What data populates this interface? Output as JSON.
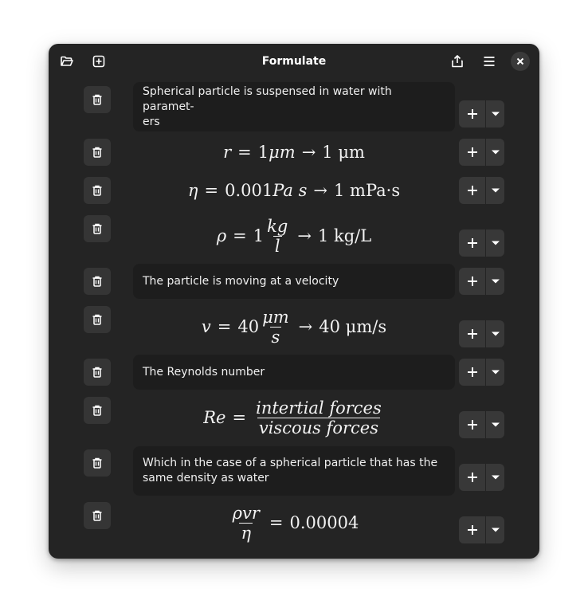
{
  "window": {
    "title": "Formulate",
    "icons": {
      "open": "folder-open-icon",
      "new": "add-document-icon",
      "share": "share-icon",
      "menu": "hamburger-menu-icon",
      "close": "close-icon"
    }
  },
  "cells": [
    {
      "type": "text",
      "text": "Spherical particle is suspensed in water with paramet-",
      "text2": "ers"
    },
    {
      "type": "math",
      "lhs": "r",
      "rel": "=",
      "val": "1",
      "unit": "μm",
      "arrow": "→",
      "result": "1 μm"
    },
    {
      "type": "math",
      "lhs": "η",
      "rel": "=",
      "val": "0.001",
      "unit": "Pa s",
      "arrow": "→",
      "result": "1 mPa·s"
    },
    {
      "type": "math",
      "lhs": "ρ",
      "rel": "=",
      "val": "1",
      "num": "kg",
      "den": "l",
      "arrow": "→",
      "result": "1 kg/L"
    },
    {
      "type": "text",
      "text": "The particle is moving at a velocity"
    },
    {
      "type": "math",
      "lhs": "v",
      "rel": "=",
      "val": "40",
      "num": "μm",
      "den": "s",
      "arrow": "→",
      "result": "40 μm/s"
    },
    {
      "type": "text",
      "text": "The Reynolds number"
    },
    {
      "type": "math",
      "lhs": "Re",
      "rel": "=",
      "num": "intertial forces",
      "den": "viscous forces"
    },
    {
      "type": "text",
      "text": "Which in the case of a spherical particle that has the",
      "text2": "same density as water"
    },
    {
      "type": "math",
      "num": "ρvr",
      "den": "η",
      "rel": "=",
      "result": "0.00004"
    }
  ],
  "colors": {
    "window_bg": "#242424",
    "text_cell_bg": "#1d1d1d",
    "button_bg": "#383838",
    "foreground": "#ffffff"
  }
}
